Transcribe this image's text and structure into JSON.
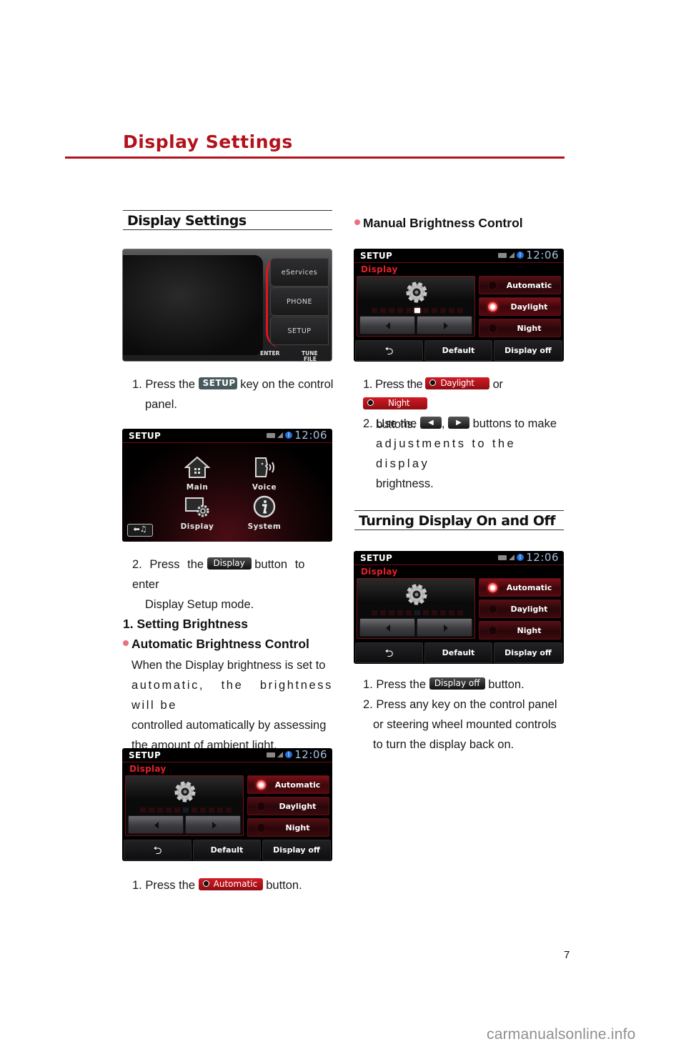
{
  "page": {
    "title": "Display Settings",
    "page_number": "7",
    "watermark": "carmanualsonline.info",
    "accent_color": "#b3121c"
  },
  "left_column": {
    "section_heading": "Display Settings",
    "control_panel": {
      "keys": [
        "eServices",
        "PHONE",
        "SETUP"
      ],
      "labels": {
        "enter": "ENTER",
        "tune": "TUNE",
        "file": "FILE"
      }
    },
    "step1": {
      "prefix": "1. Press the",
      "chip": "SETUP",
      "suffix": "key on the control",
      "cont": "panel."
    },
    "setup_menu_screen": {
      "title": "SETUP",
      "clock": "12:06",
      "items": [
        {
          "label": "Main",
          "icon": "home-icon"
        },
        {
          "label": "Voice",
          "icon": "voice-icon"
        },
        {
          "label": "Display",
          "icon": "display-gear-icon"
        },
        {
          "label": "System",
          "icon": "info-icon"
        }
      ],
      "return_glyph": "⬅♫"
    },
    "step2": {
      "prefix": "2. Press the",
      "chip": "Display",
      "suffix": "button to enter",
      "cont": "Display Setup mode."
    },
    "subheading": "1. Setting Brightness",
    "bullet_heading": "Automatic Brightness Control",
    "paragraph_lines": [
      "When the Display brightness is set to",
      "automatic, the brightness will be",
      "controlled automatically by assessing",
      "the amount of ambient light."
    ],
    "auto_screen": {
      "title": "SETUP",
      "subtitle": "Display",
      "clock": "12:06",
      "modes": [
        "Automatic",
        "Daylight",
        "Night"
      ],
      "selected_mode": "Automatic",
      "brightness_levels": 11,
      "brightness_current": 6,
      "bottom_buttons": [
        "⮌",
        "Default",
        "Display off"
      ]
    },
    "step3": {
      "prefix": "1. Press the",
      "chip": "Automatic",
      "suffix": "button."
    }
  },
  "right_column": {
    "bullet_heading": "Manual Brightness Control",
    "manual_screen": {
      "title": "SETUP",
      "subtitle": "Display",
      "clock": "12:06",
      "modes": [
        "Automatic",
        "Daylight",
        "Night"
      ],
      "selected_mode": "Daylight",
      "brightness_levels": 11,
      "brightness_current": 6,
      "bottom_buttons": [
        "⮌",
        "Default",
        "Display off"
      ]
    },
    "step1": {
      "prefix": "1. Press the",
      "chip_a": "Daylight",
      "mid": "or",
      "chip_b": "Night",
      "cont": "buttons."
    },
    "step2": {
      "prefix": "2. Use the",
      "left_chip": "◀",
      "sep": ",",
      "right_chip": "▶",
      "suffix": "buttons to make",
      "cont1": "adjustments to the display",
      "cont2": "brightness."
    },
    "section_heading": "Turning Display On and Off",
    "onoff_screen": {
      "title": "SETUP",
      "subtitle": "Display",
      "clock": "12:06",
      "modes": [
        "Automatic",
        "Daylight",
        "Night"
      ],
      "selected_mode": "Automatic",
      "brightness_levels": 11,
      "brightness_current": 6,
      "bottom_buttons": [
        "⮌",
        "Default",
        "Display off"
      ]
    },
    "step3": {
      "prefix": "1. Press the",
      "chip": "Display off",
      "suffix": "button."
    },
    "step4_lines": [
      "2. Press any key on the control panel",
      "or steering wheel mounted controls",
      "to turn the display back on."
    ]
  }
}
